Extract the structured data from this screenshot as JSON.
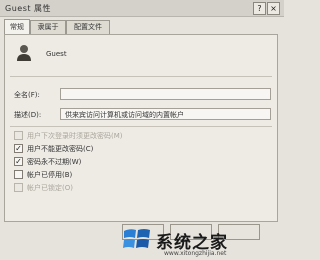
{
  "window": {
    "title": "Guest 属性",
    "help_glyph": "?",
    "close_glyph": "×"
  },
  "tabs": [
    "常规",
    "隶属于",
    "配置文件"
  ],
  "user": {
    "name": "Guest",
    "icon": "user-icon"
  },
  "fields": {
    "fullname_label": "全名(F):",
    "fullname_value": "",
    "description_label": "描述(D):",
    "description_value": "供来宾访问计算机或访问域的内置帐户"
  },
  "checkboxes": [
    {
      "label": "用户下次登录时须更改密码(M)",
      "checked": false,
      "disabled": true
    },
    {
      "label": "用户不能更改密码(C)",
      "checked": true,
      "disabled": false
    },
    {
      "label": "密码永不过期(W)",
      "checked": true,
      "disabled": false
    },
    {
      "label": "帐户已停用(B)",
      "checked": false,
      "disabled": false
    },
    {
      "label": "帐户已锁定(O)",
      "checked": false,
      "disabled": true
    }
  ],
  "watermark": {
    "text": "系统之家",
    "url": "www.xitongzhijia.net"
  }
}
